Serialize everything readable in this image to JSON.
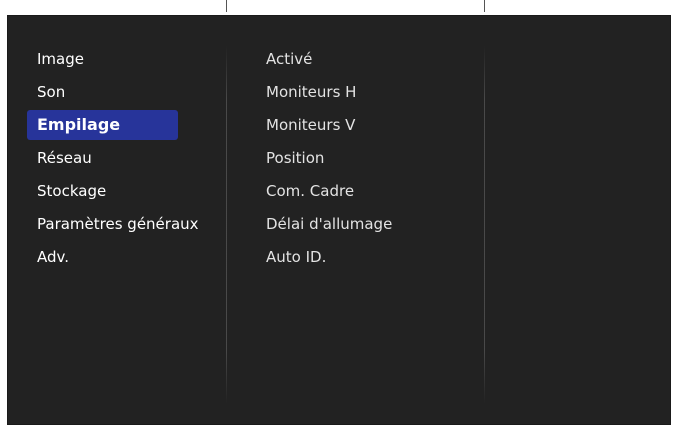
{
  "main_menu": {
    "items": [
      {
        "label": "Image"
      },
      {
        "label": "Son"
      },
      {
        "label": "Empilage",
        "selected": true
      },
      {
        "label": "Réseau"
      },
      {
        "label": "Stockage"
      },
      {
        "label": "Paramètres généraux"
      },
      {
        "label": "Adv."
      }
    ]
  },
  "submenu": {
    "items": [
      {
        "label": "Activé"
      },
      {
        "label": "Moniteurs H"
      },
      {
        "label": "Moniteurs V"
      },
      {
        "label": "Position"
      },
      {
        "label": "Com. Cadre"
      },
      {
        "label": "Délai d'allumage"
      },
      {
        "label": "Auto ID."
      }
    ]
  },
  "colors": {
    "panel_background": "#222222",
    "selection_highlight": "#27349a",
    "text": "#ffffff"
  }
}
